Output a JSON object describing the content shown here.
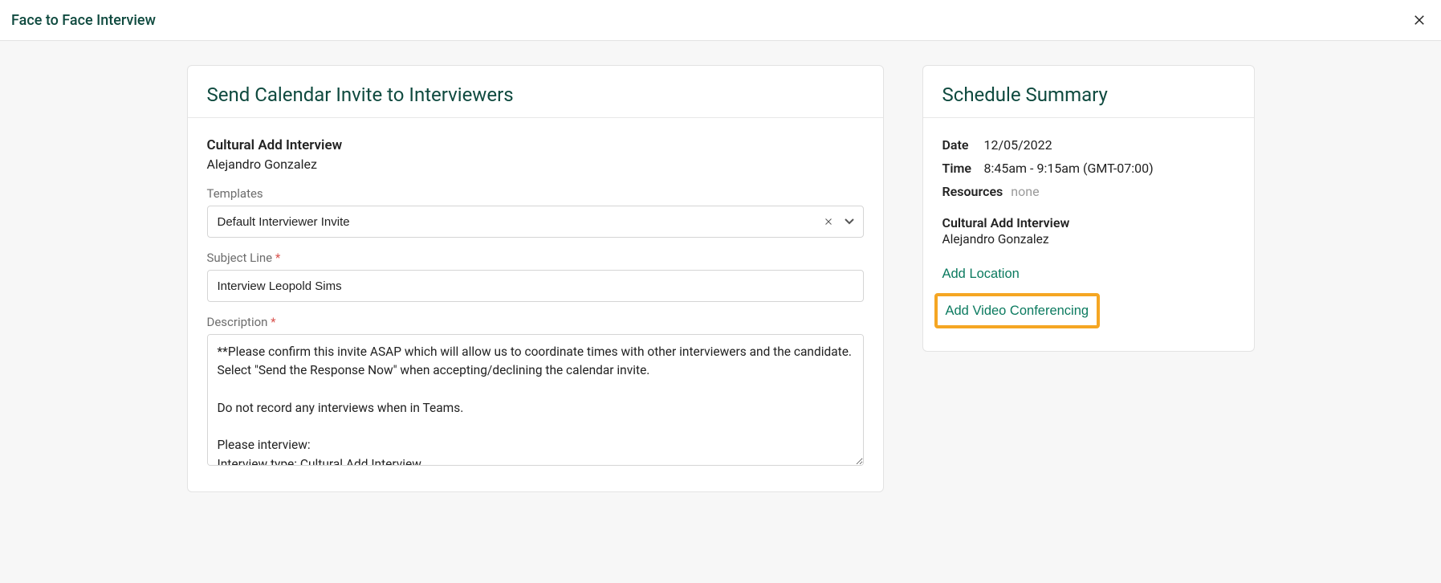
{
  "header": {
    "title": "Face to Face Interview"
  },
  "main": {
    "card_title": "Send Calendar Invite to Interviewers",
    "interview_type": "Cultural Add Interview",
    "interviewer": "Alejandro Gonzalez",
    "templates": {
      "label": "Templates",
      "selected": "Default Interviewer Invite"
    },
    "subject": {
      "label": "Subject Line",
      "value": "Interview Leopold Sims"
    },
    "description": {
      "label": "Description",
      "value": "**Please confirm this invite ASAP which will allow us to coordinate times with other interviewers and the candidate. Select \"Send the Response Now\" when accepting/declining the calendar invite.\n\nDo not record any interviews when in Teams.\n\nPlease interview:\nInterview type: Cultural Add Interview"
    }
  },
  "summary": {
    "title": "Schedule Summary",
    "date_label": "Date",
    "date_value": "12/05/2022",
    "time_label": "Time",
    "time_value": "8:45am - 9:15am (GMT-07:00)",
    "resources_label": "Resources",
    "resources_value": "none",
    "interview_type": "Cultural Add Interview",
    "interviewer": "Alejandro Gonzalez",
    "add_location_label": "Add Location",
    "add_video_label": "Add Video Conferencing"
  }
}
